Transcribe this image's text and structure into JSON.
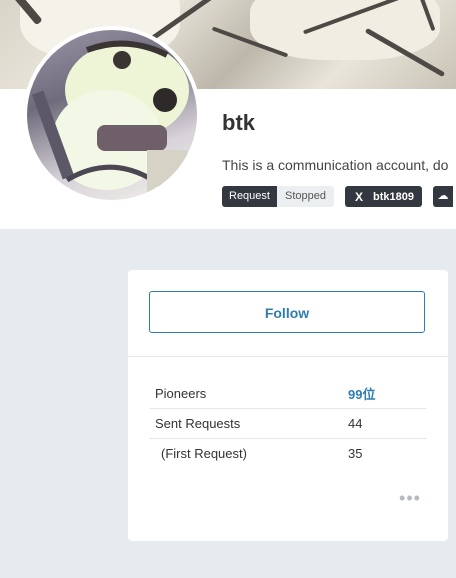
{
  "profile": {
    "username": "btk",
    "bio": "This is a communication account, do"
  },
  "badges": {
    "request_label": "Request",
    "request_status": "Stopped",
    "x_icon": "X",
    "x_handle": "btk1809",
    "extra_icon": "link-icon"
  },
  "card": {
    "follow_label": "Follow",
    "stats": [
      {
        "label": "Pioneers",
        "value": "99位"
      },
      {
        "label": "Sent Requests",
        "value": "44"
      },
      {
        "label": "(First Request)",
        "value": "35"
      }
    ],
    "more_icon": "•••"
  },
  "colors": {
    "accent": "#2f7db3",
    "badge_dark": "#333840",
    "page_bg": "#e6ebf0"
  }
}
